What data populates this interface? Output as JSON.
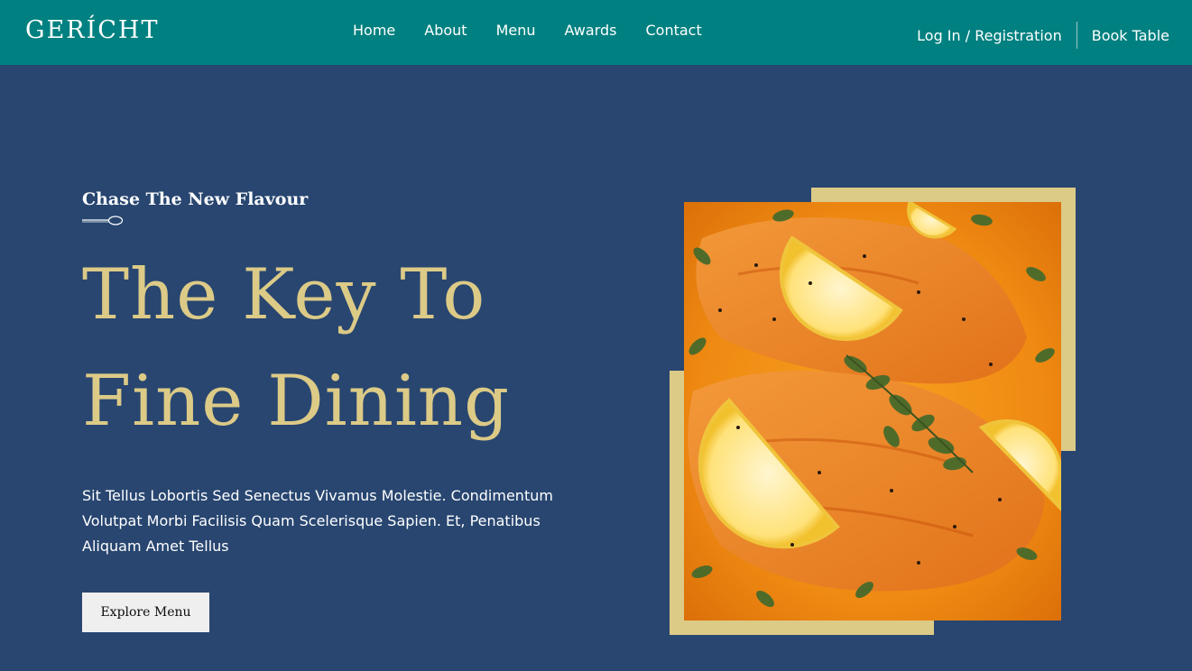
{
  "nav": {
    "logo": "GERÍCHT",
    "links": [
      "Home",
      "About",
      "Menu",
      "Awards",
      "Contact"
    ],
    "login_label": "Log In / Registration",
    "book_label": "Book Table"
  },
  "hero": {
    "subtitle": "Chase The New Flavour",
    "headline": "The Key To Fine Dining",
    "description": "Sit Tellus Lobortis Sed Senectus Vivamus Molestie. Condimentum Volutpat Morbi Facilisis Quam Scelerisque Sapien. Et, Penatibus Aliquam Amet Tellus",
    "button_label": "Explore Menu"
  },
  "colors": {
    "navbar": "#008080",
    "background": "#284670",
    "accent_gold": "#dcca87",
    "text_white": "#ffffff",
    "button_bg": "#efefef"
  },
  "icons": {
    "spoon": "spoon-icon"
  }
}
